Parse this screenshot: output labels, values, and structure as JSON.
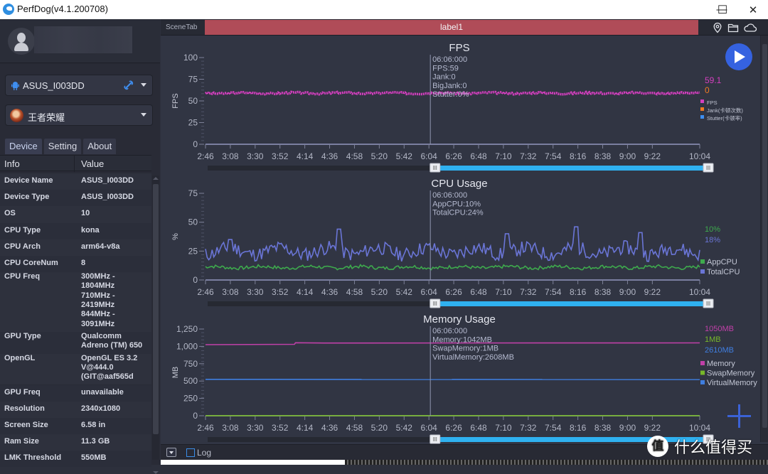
{
  "window": {
    "title": "PerfDog(v4.1.200708)",
    "minimize_glyph": "—",
    "maximize_glyph": "☐",
    "close_glyph": "✕"
  },
  "sidebar": {
    "device_select": {
      "value": "ASUS_I003DD",
      "icon": "android-icon",
      "connection_icon": "usb-link-icon"
    },
    "app_select": {
      "value": "王者荣耀",
      "icon": "game-app-icon"
    },
    "tabs": [
      {
        "label": "Device",
        "active": true
      },
      {
        "label": "Setting",
        "active": false
      },
      {
        "label": "About",
        "active": false
      }
    ],
    "table": {
      "headers": [
        "Info",
        "Value"
      ],
      "rows": [
        {
          "key": "Device Name",
          "value": [
            "ASUS_I003DD"
          ]
        },
        {
          "key": "Device Type",
          "value": [
            "ASUS_I003DD"
          ]
        },
        {
          "key": "OS",
          "value": [
            "10"
          ]
        },
        {
          "key": "CPU Type",
          "value": [
            "kona"
          ]
        },
        {
          "key": "CPU Arch",
          "value": [
            "arm64-v8a"
          ]
        },
        {
          "key": "CPU CoreNum",
          "value": [
            "8"
          ]
        },
        {
          "key": "CPU Freq",
          "value": [
            "300MHz -",
            "1804MHz",
            "710MHz -",
            "2419MHz",
            "844MHz -",
            "3091MHz"
          ]
        },
        {
          "key": "GPU Type",
          "value": [
            "Qualcomm",
            "Adreno (TM) 650"
          ]
        },
        {
          "key": "OpenGL",
          "value": [
            "OpenGL ES 3.2",
            "V@444.0",
            "(GIT@aaf565d"
          ]
        },
        {
          "key": "GPU Freq",
          "value": [
            "unavailable"
          ]
        },
        {
          "key": "Resolution",
          "value": [
            "2340x1080"
          ]
        },
        {
          "key": "Screen Size",
          "value": [
            "6.58 in"
          ]
        },
        {
          "key": "Ram Size",
          "value": [
            "11.3 GB"
          ]
        },
        {
          "key": "LMK Threshold",
          "value": [
            "550MB"
          ]
        }
      ]
    }
  },
  "main": {
    "scene_tab_label": "SceneTab",
    "scene_label": "label1",
    "top_icons": [
      "location-pin-icon",
      "folder-icon",
      "cloud-icon"
    ],
    "play_button": "play-icon",
    "add_button": "plus-icon",
    "log_label": "Log",
    "log_checked": false,
    "range_slider": {
      "start_fraction": 0.45,
      "end_fraction": 1.0
    },
    "colors": {
      "background": "#313543",
      "axis": "#7a7ea0",
      "fps": "#d43fbf",
      "jank": "#f07a22",
      "stutter": "#3e8ef0",
      "app_cpu": "#3eaa4d",
      "total_cpu": "#6a75d6",
      "memory": "#c040a8",
      "swap_memory": "#77b82a",
      "virtual_memory": "#3f7ee0",
      "slider": "#2fb1f0",
      "play": "#3562e0",
      "cursor": "#9095b0"
    }
  },
  "watermark": {
    "badge": "值",
    "text": "什么值得买"
  },
  "chart_data": [
    {
      "type": "line",
      "title": "FPS",
      "ylabel": "FPS",
      "xlabel": "",
      "ylim": [
        0,
        100
      ],
      "yticks": [
        "0",
        "25",
        "50",
        "75",
        "100"
      ],
      "ytick_values": [
        0,
        25,
        50,
        75,
        100
      ],
      "x_tick_labels": [
        "2:46",
        "3:08",
        "3:30",
        "3:52",
        "4:14",
        "4:36",
        "4:58",
        "5:20",
        "5:42",
        "6:04",
        "6:26",
        "6:48",
        "7:10",
        "7:32",
        "7:54",
        "8:16",
        "8:38",
        "9:00",
        "9:22",
        "10:04"
      ],
      "x_range_seconds": [
        166,
        604
      ],
      "cursor": {
        "time": "06:06:000",
        "lines": [
          "06:06:000",
          "FPS:59",
          "Jank:0",
          "BigJank:0",
          "Stutter:0%"
        ]
      },
      "current_values": [
        {
          "text": "59.1",
          "color_key": "fps"
        },
        {
          "text": "0",
          "color_key": "jank"
        }
      ],
      "legend": [
        {
          "label": "FPS",
          "color_key": "fps"
        },
        {
          "label": "Jank(卡顿次数)",
          "color_key": "jank"
        },
        {
          "label": "Stutter(卡顿率)",
          "color_key": "stutter"
        }
      ],
      "series": [
        {
          "name": "FPS",
          "color_key": "fps",
          "mean": 59,
          "jitter": 1.0,
          "seed": 3
        },
        {
          "name": "Jank",
          "color_key": "axis",
          "mean": 0,
          "jitter": 0,
          "seed": 1
        }
      ]
    },
    {
      "type": "line",
      "title": "CPU Usage",
      "ylabel": "%",
      "xlabel": "",
      "ylim": [
        0,
        75
      ],
      "yticks": [
        "0",
        "25",
        "50",
        "75"
      ],
      "ytick_values": [
        0,
        25,
        50,
        75
      ],
      "x_tick_labels": [
        "2:46",
        "3:08",
        "3:30",
        "3:52",
        "4:14",
        "4:36",
        "4:58",
        "5:20",
        "5:42",
        "6:04",
        "6:26",
        "6:48",
        "7:10",
        "7:32",
        "7:54",
        "8:16",
        "8:38",
        "9:00",
        "9:22",
        "10:04"
      ],
      "x_range_seconds": [
        166,
        604
      ],
      "cursor": {
        "time": "06:06:000",
        "lines": [
          "06:06:000",
          "AppCPU:10%",
          "TotalCPU:24%"
        ]
      },
      "current_values": [
        {
          "text": "10%",
          "color_key": "app_cpu"
        },
        {
          "text": "18%",
          "color_key": "total_cpu"
        }
      ],
      "legend": [
        {
          "label": "AppCPU",
          "color_key": "app_cpu"
        },
        {
          "label": "TotalCPU",
          "color_key": "total_cpu"
        }
      ],
      "series": [
        {
          "name": "AppCPU",
          "color_key": "app_cpu",
          "mean": 11,
          "jitter": 1.5,
          "seed": 7
        },
        {
          "name": "TotalCPU",
          "color_key": "total_cpu",
          "mean": 25,
          "jitter": 6,
          "seed": 11,
          "spikes": [
            [
              0.05,
              35
            ],
            [
              0.27,
              44
            ],
            [
              0.61,
              40
            ],
            [
              0.75,
              46
            ],
            [
              0.88,
              41
            ]
          ]
        }
      ]
    },
    {
      "type": "line",
      "title": "Memory Usage",
      "ylabel": "MB",
      "xlabel": "",
      "ylim": [
        0,
        1250
      ],
      "yticks": [
        "0",
        "250",
        "500",
        "750",
        "1,000",
        "1,250"
      ],
      "ytick_values": [
        0,
        250,
        500,
        750,
        1000,
        1250
      ],
      "x_tick_labels": [
        "2:46",
        "3:08",
        "3:30",
        "3:52",
        "4:14",
        "4:36",
        "4:58",
        "5:20",
        "5:42",
        "6:04",
        "6:26",
        "6:48",
        "7:10",
        "7:32",
        "7:54",
        "8:16",
        "8:38",
        "9:00",
        "9:22",
        "10:04"
      ],
      "x_range_seconds": [
        166,
        604
      ],
      "cursor": {
        "time": "06:06:000",
        "lines": [
          "06:06:000",
          "Memory:1042MB",
          "SwapMemory:1MB",
          "VirtualMemory:2608MB"
        ]
      },
      "current_values": [
        {
          "text": "1050MB",
          "color_key": "memory"
        },
        {
          "text": "1MB",
          "color_key": "swap_memory"
        },
        {
          "text": "2610MB",
          "color_key": "virtual_memory"
        }
      ],
      "legend": [
        {
          "label": "Memory",
          "color_key": "memory"
        },
        {
          "label": "SwapMemory",
          "color_key": "swap_memory"
        },
        {
          "label": "VirtualMemory",
          "color_key": "virtual_memory"
        }
      ],
      "series": [
        {
          "name": "Memory",
          "color_key": "memory",
          "steps": [
            [
              0,
              1025
            ],
            [
              0.18,
              1030
            ],
            [
              0.182,
              1052
            ],
            [
              0.24,
              1048
            ],
            [
              1.0,
              1050
            ]
          ]
        },
        {
          "name": "SwapMemory",
          "color_key": "swap_memory",
          "steps": [
            [
              0,
              1
            ],
            [
              1.0,
              1
            ]
          ]
        },
        {
          "name": "VirtualMemory",
          "color_key": "virtual_memory",
          "steps": [
            [
              0,
              525
            ],
            [
              1.0,
              522
            ]
          ]
        }
      ]
    }
  ]
}
